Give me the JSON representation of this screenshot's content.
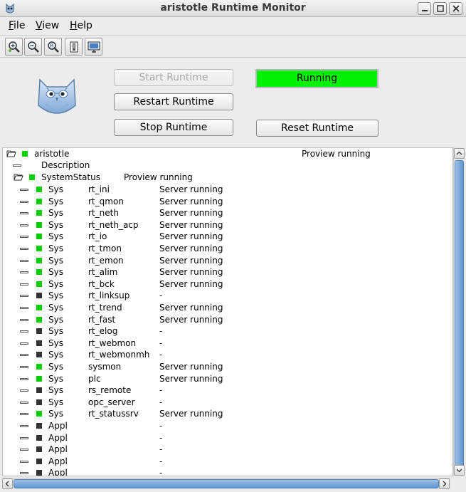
{
  "window": {
    "title": "aristotle Runtime Monitor"
  },
  "menu": [
    {
      "mnemonic": "F",
      "rest": "ile"
    },
    {
      "mnemonic": "V",
      "rest": "iew"
    },
    {
      "mnemonic": "H",
      "rest": "elp"
    }
  ],
  "toolbar": {
    "icons": [
      "zoom-in-icon",
      "zoom-out-icon",
      "zoom-reset-icon",
      "open-object-icon",
      "monitor-icon"
    ]
  },
  "controls": {
    "start_label": "Start Runtime",
    "restart_label": "Restart Runtime",
    "stop_label": "Stop Runtime",
    "reset_label": "Reset Runtime",
    "status_label": "Running",
    "status_color": "#00f200"
  },
  "tree": {
    "root": {
      "name": "aristotle",
      "status": "Proview running",
      "status_color": "#00d000"
    },
    "description_label": "Description",
    "system_status": {
      "name": "SystemStatus",
      "status": "Proview running",
      "status_color": "#00d000"
    },
    "colors": {
      "running": "#00d000",
      "stopped": "#333333"
    },
    "rows": [
      {
        "group": "Sys",
        "name": "rt_ini",
        "status": "Server running",
        "running": true
      },
      {
        "group": "Sys",
        "name": "rt_qmon",
        "status": "Server running",
        "running": true
      },
      {
        "group": "Sys",
        "name": "rt_neth",
        "status": "Server running",
        "running": true
      },
      {
        "group": "Sys",
        "name": "rt_neth_acp",
        "status": "Server running",
        "running": true
      },
      {
        "group": "Sys",
        "name": "rt_io",
        "status": "Server running",
        "running": true
      },
      {
        "group": "Sys",
        "name": "rt_tmon",
        "status": "Server running",
        "running": true
      },
      {
        "group": "Sys",
        "name": "rt_emon",
        "status": "Server running",
        "running": true
      },
      {
        "group": "Sys",
        "name": "rt_alim",
        "status": "Server running",
        "running": true
      },
      {
        "group": "Sys",
        "name": "rt_bck",
        "status": "Server running",
        "running": true
      },
      {
        "group": "Sys",
        "name": "rt_linksup",
        "status": "-",
        "running": false
      },
      {
        "group": "Sys",
        "name": "rt_trend",
        "status": "Server running",
        "running": true
      },
      {
        "group": "Sys",
        "name": "rt_fast",
        "status": "Server running",
        "running": true
      },
      {
        "group": "Sys",
        "name": "rt_elog",
        "status": "-",
        "running": false
      },
      {
        "group": "Sys",
        "name": "rt_webmon",
        "status": "-",
        "running": false
      },
      {
        "group": "Sys",
        "name": "rt_webmonmh",
        "status": "-",
        "running": false
      },
      {
        "group": "Sys",
        "name": "sysmon",
        "status": "Server running",
        "running": true
      },
      {
        "group": "Sys",
        "name": "plc",
        "status": "Server running",
        "running": true
      },
      {
        "group": "Sys",
        "name": "rs_remote",
        "status": "-",
        "running": false
      },
      {
        "group": "Sys",
        "name": "opc_server",
        "status": "-",
        "running": false
      },
      {
        "group": "Sys",
        "name": "rt_statussrv",
        "status": "Server running",
        "running": true
      },
      {
        "group": "Appl",
        "name": "",
        "status": "-",
        "running": false
      },
      {
        "group": "Appl",
        "name": "",
        "status": "-",
        "running": false
      },
      {
        "group": "Appl",
        "name": "",
        "status": "-",
        "running": false
      },
      {
        "group": "Appl",
        "name": "",
        "status": "-",
        "running": false
      },
      {
        "group": "Appl",
        "name": "",
        "status": "-",
        "running": false
      }
    ]
  }
}
